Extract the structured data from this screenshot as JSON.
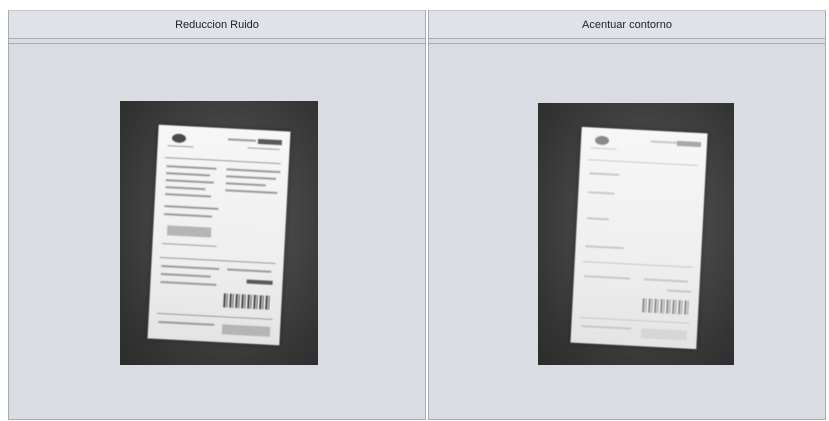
{
  "panels": [
    {
      "title": "Reduccion Ruido"
    },
    {
      "title": "Acentuar contorno"
    }
  ]
}
